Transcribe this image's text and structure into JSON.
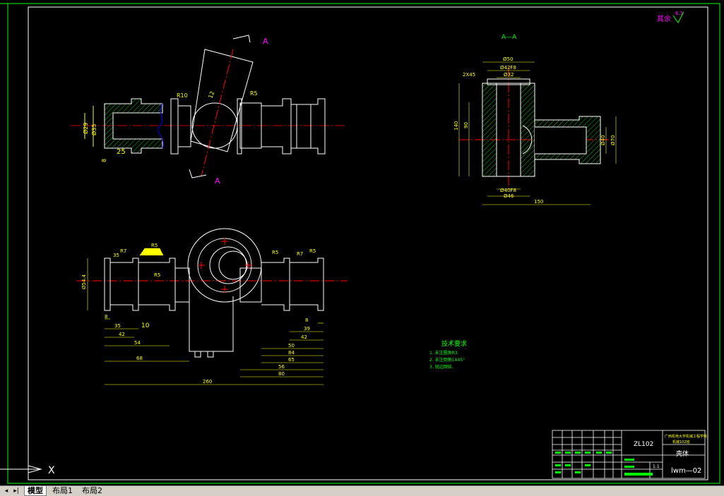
{
  "colors": {
    "background": "#000000",
    "outline": "#ffffff",
    "dimension": "#ffff00",
    "centerline": "#ff0000",
    "hatch": "#00c000",
    "label": "#ff00ff",
    "notes": "#00ff00",
    "tab_bar": "#d4d0c8"
  },
  "drawing": {
    "section_marker_top": "A",
    "section_marker_bottom": "A",
    "section_title": "A—A",
    "roughness_label": "其余",
    "roughness_value": "6.3",
    "top_view_dims": [
      "R10",
      "R5",
      "12",
      "Ø29",
      "Ø35",
      "25",
      "8"
    ],
    "section_dims": [
      "Ø50",
      "Ø42F8",
      "Ø32",
      "Ø40F8",
      "Ø46",
      "2X45",
      "140",
      "90",
      "150",
      "Ø40",
      "Ø70"
    ],
    "front_view_dims": [
      "35",
      "R7",
      "R5",
      "R5",
      "R5",
      "Ø54.4",
      "R5",
      "8",
      "35",
      "10",
      "42",
      "54",
      "68",
      "260",
      "R5",
      "R7",
      "R5",
      "8",
      "39",
      "42",
      "50",
      "84",
      "65",
      "56",
      "80"
    ]
  },
  "notes": {
    "title": "技术要求",
    "lines": [
      "1. 未注圆角R3.",
      "2. 未注倒角1X45°",
      "3. 锐边倒钝."
    ]
  },
  "title_block": {
    "material": "ZL102",
    "school": "广西机电大学机械工程学院",
    "class": "机械102班",
    "part_name": "壳体",
    "scale": "1:1",
    "drawing_number": "lwm—02"
  },
  "tabs": {
    "nav_first": "◂",
    "nav_last": "▸|",
    "items": [
      {
        "label": "模型",
        "active": true
      },
      {
        "label": "布局1",
        "active": false
      },
      {
        "label": "布局2",
        "active": false
      }
    ]
  },
  "ucs": {
    "x_label": "X"
  }
}
